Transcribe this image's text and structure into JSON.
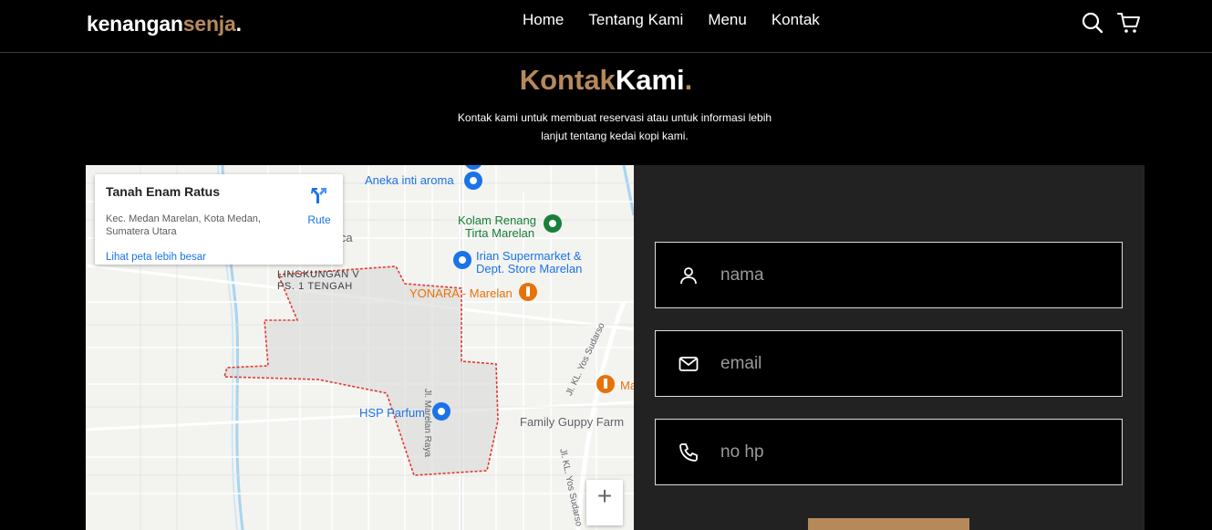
{
  "brand": {
    "part1": "kenangan",
    "part2": "senja",
    "dot": "."
  },
  "nav": {
    "items": [
      "Home",
      "Tentang Kami",
      "Menu",
      "Kontak"
    ]
  },
  "icons": {
    "search": "search-icon",
    "cart": "cart-icon"
  },
  "section": {
    "title_part1": "Kontak",
    "title_part2": "Kami",
    "title_dot": ".",
    "subtitle": "Kontak kami untuk membuat reservasi atau untuk informasi lebih lanjut tentang kedai kopi kami."
  },
  "map": {
    "place_name": "Tanah Enam Ratus",
    "address": "Kec. Medan Marelan, Kota Medan, Sumatera Utara",
    "route_label": "Rute",
    "larger_map_link": "Lihat peta lebih besar",
    "zoom_in": "+",
    "labels": {
      "aneka": "Aneka inti aroma",
      "kolam1": "Kolam Renang",
      "kolam2": "Tirta Marelan",
      "irian1": "Irian Supermarket &",
      "irian2": "Dept. Store Marelan",
      "yonara": "YONARA - Marelan",
      "lingkungan1": "LINGKUNGAN V",
      "lingkungan2": "PS. 1 TENGAH",
      "hsp": "HSP Parfum",
      "family": "Family Guppy Farm",
      "marelan_raya": "Jl. Marelan Raya",
      "yos1": "Jl. KL. Yos Sudarso",
      "yos2": "Jl. KL. Yos Sudarso",
      "yos3": "Jl. KL. Yos Sudarso",
      "taca": "taca",
      "ma": "Ma"
    }
  },
  "form": {
    "name_placeholder": "nama",
    "email_placeholder": "email",
    "phone_placeholder": "no hp",
    "accent_color": "#b6895b"
  }
}
